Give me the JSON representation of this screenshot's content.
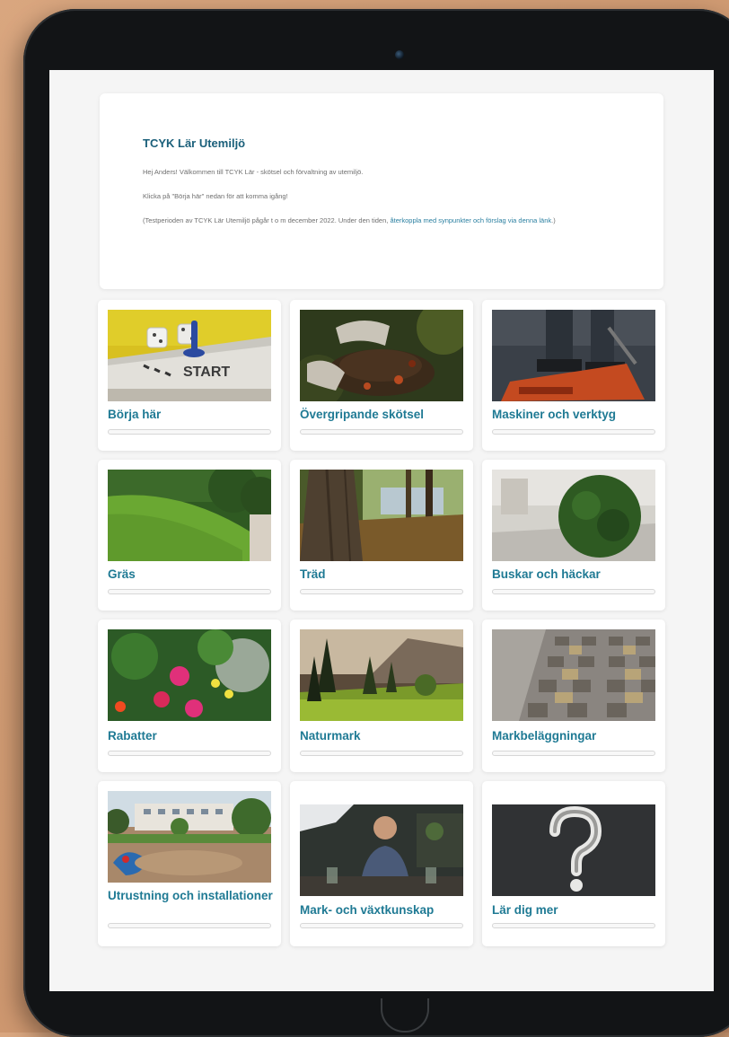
{
  "intro": {
    "title": "TCYK Lär Utemiljö",
    "greeting": "Hej Anders! Välkommen till TCYK Lär - skötsel och förvaltning av utemiljö.",
    "instruction": "Klicka på \"Börja här\" nedan för att komma igång!",
    "note_prefix": "(Testperioden av TCYK Lär Utemiljö pågår t o m december 2022. Under den tiden, ",
    "note_link": "återkoppla med synpunkter och förslag via denna länk",
    "note_suffix": ".)"
  },
  "courses": [
    {
      "label": "Börja här",
      "image": "board-game-start",
      "progress": 0
    },
    {
      "label": "Övergripande skötsel",
      "image": "hands-soil",
      "progress": 0
    },
    {
      "label": "Maskiner och verktyg",
      "image": "lawn-mower",
      "progress": 0
    },
    {
      "label": "Gräs",
      "image": "grass-slope",
      "progress": 0
    },
    {
      "label": "Träd",
      "image": "tree-trunk",
      "progress": 0
    },
    {
      "label": "Buskar och häckar",
      "image": "round-bush",
      "progress": 0
    },
    {
      "label": "Rabatter",
      "image": "flower-bed",
      "progress": 0
    },
    {
      "label": "Naturmark",
      "image": "forest-meadow",
      "progress": 0
    },
    {
      "label": "Markbeläggningar",
      "image": "paving-stones",
      "progress": 0
    },
    {
      "label": "Utrustning och installationer",
      "image": "playground",
      "progress": 0
    },
    {
      "label": "Mark- och växtkunskap",
      "image": "presenter-video",
      "progress": 0
    },
    {
      "label": "Lär dig mer",
      "image": "question-mark-chalkboard",
      "progress": 0
    }
  ],
  "colors": {
    "accent": "#1f7a94",
    "title": "#1a5f7a",
    "link": "#2a7fa0"
  }
}
